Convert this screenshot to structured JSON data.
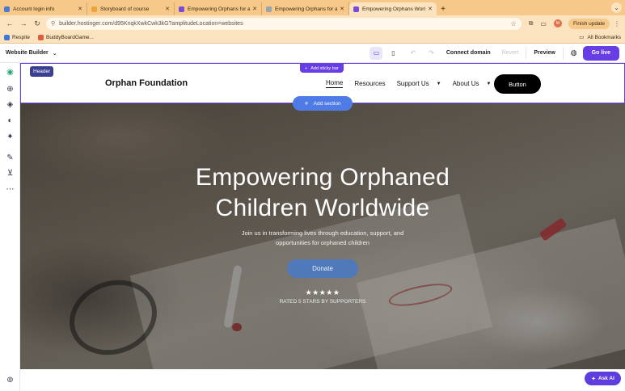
{
  "browser": {
    "tabs": [
      {
        "title": "Account login info",
        "color": "#4a7bd0"
      },
      {
        "title": "Storyboard of course",
        "color": "#e8a63a"
      },
      {
        "title": "Empowering Orphans for a B",
        "color": "#7a4ad8"
      },
      {
        "title": "Empowering Orphans for a B",
        "color": "#9aa4ad"
      },
      {
        "title": "Empowering Orphans Worldw",
        "color": "#7a4ad8",
        "active": true
      }
    ],
    "new_tab": "+",
    "url": "builder.hostinger.com/d95KnqkXwkCwk3kG?amplitudeLocation=websites",
    "finish_update": "Finish update",
    "profile_initial": "M",
    "bookmarks": [
      {
        "label": "Respite",
        "color": "#3d7ad6"
      },
      {
        "label": "BuddyBoardGame...",
        "color": "#e05b3a"
      }
    ],
    "all_bookmarks": "All Bookmarks"
  },
  "builder": {
    "title": "Website Builder",
    "connect_domain": "Connect domain",
    "revert": "Revert",
    "preview": "Preview",
    "go_live": "Go live"
  },
  "site": {
    "header_chip": "Header",
    "sticky_bar": "Add sticky bar",
    "logo": "Orphan Foundation",
    "nav": {
      "home": "Home",
      "resources": "Resources",
      "support": "Support Us",
      "about": "About Us"
    },
    "header_button": "Button",
    "add_section": "Add section",
    "hero": {
      "title_line1": "Empowering Orphaned",
      "title_line2": "Children Worldwide",
      "subtitle": "Join us in transforming lives through education, support, and opportunities for orphaned children",
      "donate": "Donate",
      "stars": "★★★★★",
      "rated": "RATED 5 STARS BY SUPPORTERS"
    }
  },
  "ask_ai": "Ask AI"
}
